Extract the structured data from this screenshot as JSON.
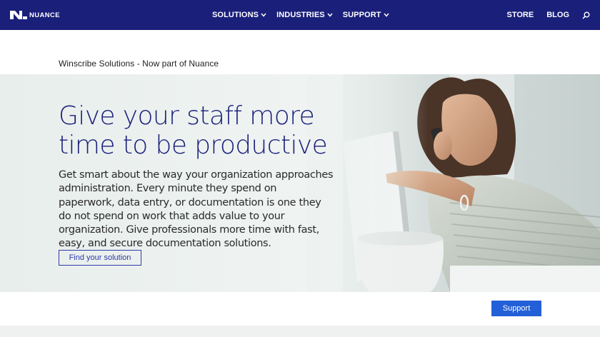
{
  "brand": {
    "logo_text": "NUANCE",
    "nav_color": "#1a1f7a"
  },
  "nav": {
    "items": [
      {
        "label": "SOLUTIONS",
        "icon": "chevron-down-icon"
      },
      {
        "label": "INDUSTRIES",
        "icon": "chevron-down-icon"
      },
      {
        "label": "SUPPORT",
        "icon": "chevron-down-icon"
      }
    ],
    "right": {
      "store": "STORE",
      "blog": "BLOG",
      "search_icon": "search-icon"
    }
  },
  "page": {
    "subtitle": "Winscribe Solutions - Now part of Nuance"
  },
  "hero": {
    "title": "Give your staff more time to be productive",
    "body": "Get smart about the way your organization approaches administration. Every minute they spend on paperwork, data entry, or documentation is one they do not spend on work that adds value to your organization. Give professionals more time with fast, easy, and secure documentation solutions.",
    "cta_label": "Find your solution",
    "accent_color": "#2f3aa6"
  },
  "footer": {
    "support_label": "Support",
    "support_color": "#2360d8"
  }
}
